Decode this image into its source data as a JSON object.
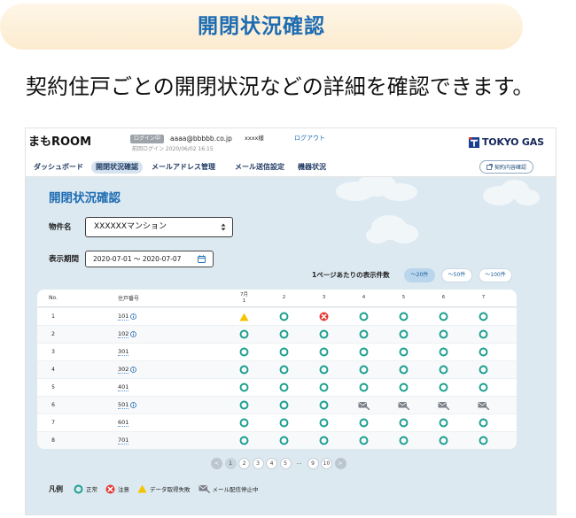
{
  "banner": {
    "title": "開閉状況確認"
  },
  "intro": {
    "text": "契約住戸ごとの開閉状況などの詳細を確認できます。"
  },
  "header": {
    "logo": "まもROOM",
    "login_badge": "ログイン中",
    "email": "aaaa@bbbbb.co.jp",
    "user_name": "xxxx様",
    "logout": "ログアウト",
    "last_login": "前回ログイン 2020/06/02 16:15",
    "brand_logo": "TOKYO GAS",
    "contract_button": "契約内容確認"
  },
  "nav": {
    "items": [
      {
        "label": "ダッシュボード",
        "active": false
      },
      {
        "label": "開閉状況確認",
        "active": true
      },
      {
        "label": "メールアドレス管理",
        "active": false
      },
      {
        "label": "メール送信設定",
        "active": false
      },
      {
        "label": "機器状況",
        "active": false
      }
    ]
  },
  "main": {
    "heading": "開閉状況確認",
    "property": {
      "label": "物件名",
      "value": "XXXXXXマンション"
    },
    "period": {
      "label": "表示期間",
      "value": "2020-07-01 ～ 2020-07-07"
    },
    "per_page": {
      "label": "1ページあたりの表示件数",
      "options": [
        "～20件",
        "～50件",
        "～100件"
      ],
      "selected": "～20件"
    }
  },
  "table": {
    "headers": {
      "no": "No.",
      "unit": "住戸番号",
      "month": "7月",
      "days": [
        "1",
        "2",
        "3",
        "4",
        "5",
        "6",
        "7"
      ]
    },
    "rows": [
      {
        "no": "1",
        "unit": "101",
        "has_info": true,
        "status": [
          "fetch-failed",
          "ok",
          "caution",
          "ok",
          "ok",
          "ok",
          "ok"
        ]
      },
      {
        "no": "2",
        "unit": "102",
        "has_info": true,
        "status": [
          "ok",
          "ok",
          "ok",
          "ok",
          "ok",
          "ok",
          "ok"
        ]
      },
      {
        "no": "3",
        "unit": "301",
        "has_info": false,
        "status": [
          "ok",
          "ok",
          "ok",
          "ok",
          "ok",
          "ok",
          "ok"
        ]
      },
      {
        "no": "4",
        "unit": "302",
        "has_info": true,
        "status": [
          "ok",
          "ok",
          "ok",
          "ok",
          "ok",
          "ok",
          "ok"
        ]
      },
      {
        "no": "5",
        "unit": "401",
        "has_info": false,
        "status": [
          "ok",
          "ok",
          "ok",
          "ok",
          "ok",
          "ok",
          "ok"
        ]
      },
      {
        "no": "6",
        "unit": "501",
        "has_info": true,
        "status": [
          "ok",
          "ok",
          "ok",
          "mail-stopped",
          "mail-stopped",
          "mail-stopped",
          "mail-stopped"
        ]
      },
      {
        "no": "7",
        "unit": "601",
        "has_info": false,
        "status": [
          "ok",
          "ok",
          "ok",
          "ok",
          "ok",
          "ok",
          "ok"
        ]
      },
      {
        "no": "8",
        "unit": "701",
        "has_info": false,
        "status": [
          "ok",
          "ok",
          "ok",
          "ok",
          "ok",
          "ok",
          "ok"
        ]
      }
    ]
  },
  "pagination": {
    "prev": "<",
    "pages": [
      "1",
      "2",
      "3",
      "4",
      "5",
      "…",
      "9",
      "10"
    ],
    "current": "1",
    "next": ">"
  },
  "legend": {
    "title": "凡例",
    "items": [
      {
        "status": "ok",
        "label": "正常"
      },
      {
        "status": "caution",
        "label": "注意"
      },
      {
        "status": "fetch-failed",
        "label": "データ取得失敗"
      },
      {
        "status": "mail-stopped",
        "label": "メール配信停止中"
      }
    ]
  },
  "status_icons": {
    "ok": "ok-circle-icon",
    "caution": "caution-x-icon",
    "fetch-failed": "warning-triangle-icon",
    "mail-stopped": "mail-stopped-icon"
  },
  "icons": {
    "select": "select-arrows-icon",
    "period": "calendar-icon",
    "contract": "external-window-icon",
    "unit_info": "info-icon",
    "brand": "tokyo-gas-mark-icon"
  },
  "colors": {
    "accent": "#1d6cb2",
    "ok": "#1a9e8f",
    "caution": "#e53935",
    "fetch_failed": "#f5c400",
    "mail_stopped": "#7b8189",
    "banner_bg": "#fcedd2",
    "main_bg": "#dde9f1"
  }
}
